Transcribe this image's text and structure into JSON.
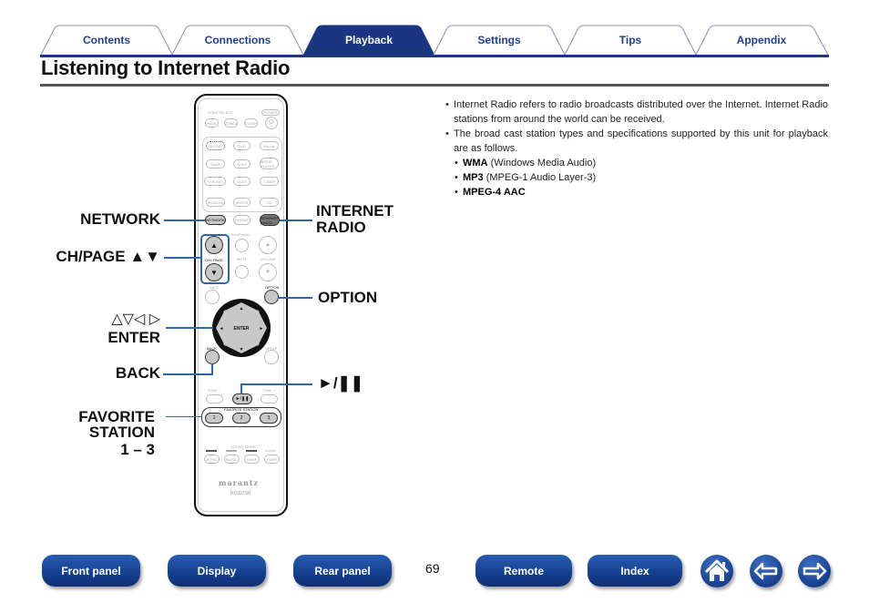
{
  "tabs": [
    {
      "label": "Contents",
      "active": false
    },
    {
      "label": "Connections",
      "active": false
    },
    {
      "label": "Playback",
      "active": true
    },
    {
      "label": "Settings",
      "active": false
    },
    {
      "label": "Tips",
      "active": false
    },
    {
      "label": "Appendix",
      "active": false
    }
  ],
  "page": {
    "title": "Listening to Internet Radio",
    "number": "69"
  },
  "description": {
    "bullets": [
      "Internet Radio refers to radio broadcasts distributed over the Internet. Internet Radio stations from around the world can be received.",
      "The broad cast station types and specifications supported by this unit for playback are as follows."
    ],
    "formats": [
      {
        "name": "WMA",
        "detail": "(Windows Media Audio)"
      },
      {
        "name": "MP3",
        "detail": "(MPEG-1 Audio Layer-3)"
      },
      {
        "name": "MPEG-4 AAC",
        "detail": ""
      }
    ]
  },
  "callouts": {
    "network": "NETWORK",
    "ch_page": "CH/PAGE ▲▼",
    "arrows": "△▽◁ ▷",
    "enter": "ENTER",
    "back": "BACK",
    "favorite_1": "FAVORITE",
    "favorite_2": "STATION",
    "favorite_3": "1 – 3",
    "internet_radio_1": "INTERNET",
    "internet_radio_2": "RADIO",
    "option": "OPTION",
    "play_pause": "►/❚❚"
  },
  "remote": {
    "zone_select": "ZONE SELECT",
    "power": "POWER",
    "row_zone": [
      "MAIN",
      "ZONE2",
      "SLEEP",
      "⏻"
    ],
    "source_rows": [
      [
        "CBL/SAT",
        "DVD",
        "Blu-ray"
      ],
      [
        "GAME",
        "AUX1",
        "MEDIA PLAYER"
      ],
      [
        "TV AUDIO",
        "AUX2",
        "TUNER"
      ],
      [
        "iPod/USB",
        "MXPort",
        "CD"
      ],
      [
        "NETWORK",
        "PHONO",
        "INTERNET RADIO"
      ]
    ],
    "info_preset": "Info/Preset",
    "ch_page": "CH / PAGE",
    "mute": "MUTE",
    "volume": "VOLUME",
    "info": "INFO",
    "option": "OPTION",
    "enter": "ENTER",
    "back": "BACK",
    "setup": "SETUP",
    "tune_minus": "TUNE –",
    "tune_plus": "TUNE +",
    "play_pause": "►/❚❚",
    "favorite_station": "FAVORITE STATION",
    "favorites": [
      "1",
      "2",
      "3"
    ],
    "sound_mode": "SOUND MODE",
    "sound_modes": [
      "MOVIE",
      "MUSIC",
      "GAME",
      "PURE"
    ],
    "brand": "marantz",
    "model": "RC022SR"
  },
  "footer": {
    "buttons": [
      "Front panel",
      "Display",
      "Rear panel",
      "Remote",
      "Index"
    ],
    "icons": [
      "home-icon",
      "back-arrow-icon",
      "forward-arrow-icon"
    ]
  },
  "colors": {
    "accent_blue": "#1c3580",
    "callout_line": "#2f68a8"
  }
}
